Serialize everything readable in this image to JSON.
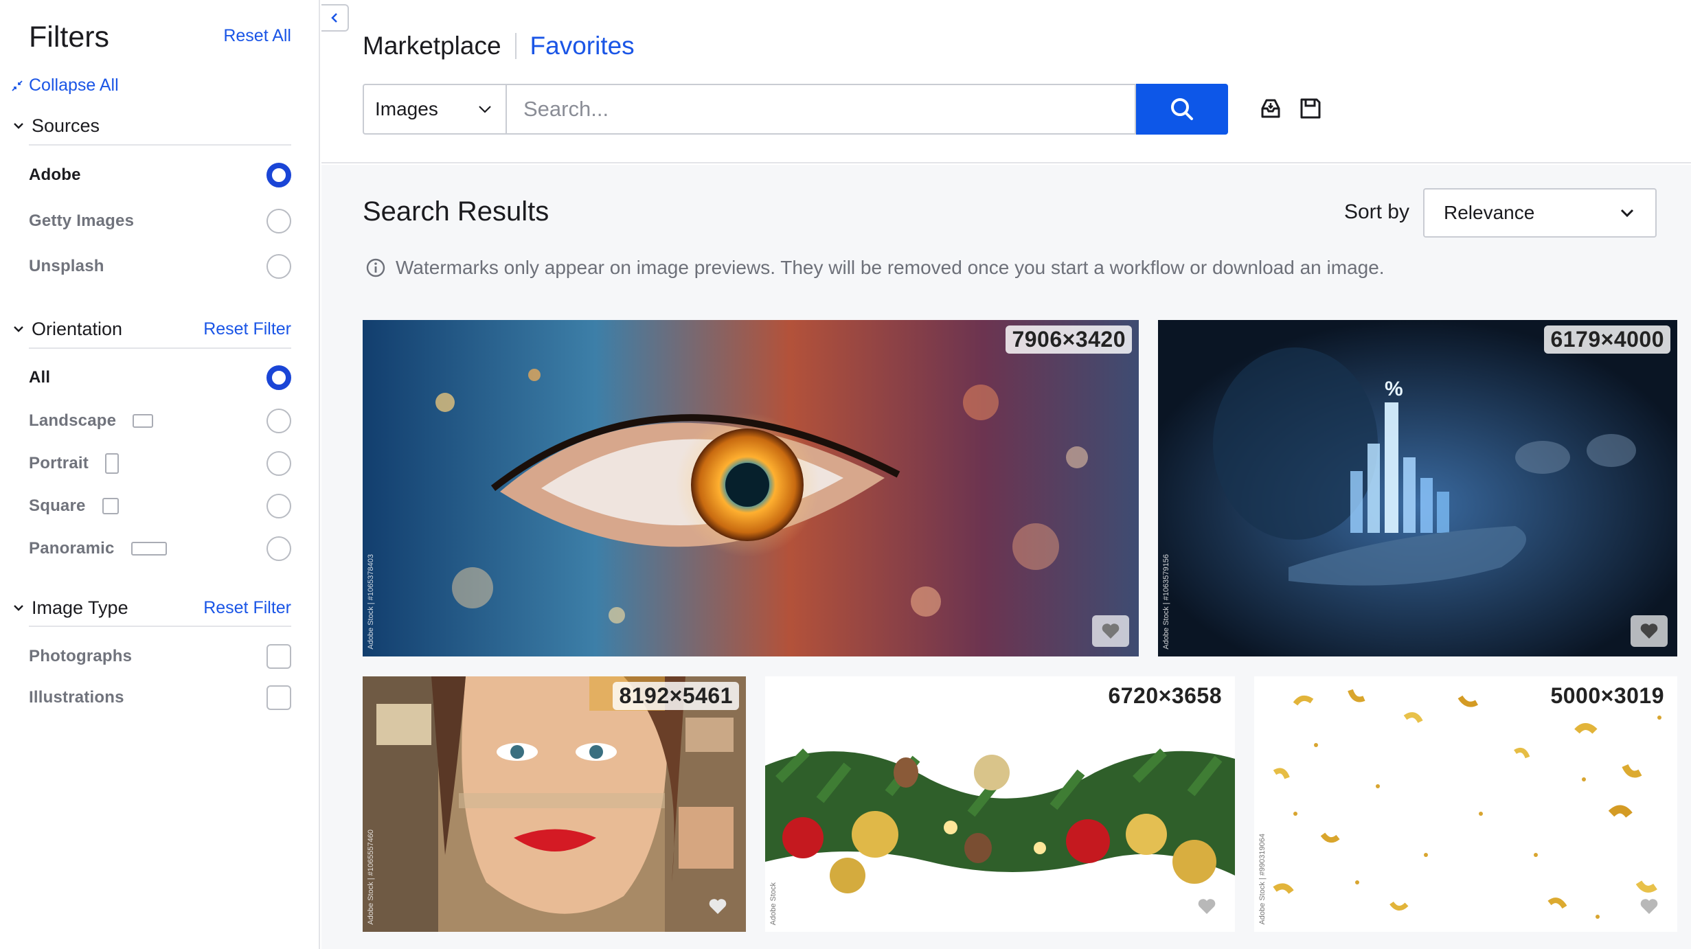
{
  "sidebar": {
    "title": "Filters",
    "reset_all": "Reset All",
    "collapse_all": "Collapse All",
    "sources": {
      "label": "Sources",
      "options": [
        {
          "label": "Adobe",
          "selected": true
        },
        {
          "label": "Getty Images",
          "selected": false
        },
        {
          "label": "Unsplash",
          "selected": false
        }
      ]
    },
    "orientation": {
      "label": "Orientation",
      "reset": "Reset Filter",
      "options": [
        {
          "label": "All",
          "selected": true
        },
        {
          "label": "Landscape",
          "selected": false
        },
        {
          "label": "Portrait",
          "selected": false
        },
        {
          "label": "Square",
          "selected": false
        },
        {
          "label": "Panoramic",
          "selected": false
        }
      ]
    },
    "image_type": {
      "label": "Image Type",
      "reset": "Reset Filter",
      "options": [
        {
          "label": "Photographs",
          "checked": false
        },
        {
          "label": "Illustrations",
          "checked": false
        }
      ]
    }
  },
  "header": {
    "breadcrumb_marketplace": "Marketplace",
    "breadcrumb_favorites": "Favorites",
    "type_select": "Images",
    "search_placeholder": "Search...",
    "icons": [
      "archive-icon",
      "save-icon"
    ]
  },
  "results": {
    "title": "Search Results",
    "sort_label": "Sort by",
    "sort_value": "Relevance",
    "notice": "Watermarks only appear on image previews. They will be removed once you start a workflow or download an image."
  },
  "tiles": [
    {
      "dims": "7906×3420",
      "subject": "eye",
      "watermark": "Adobe Stock | #1065378403"
    },
    {
      "dims": "6179×4000",
      "subject": "chart-hand",
      "watermark": "Adobe Stock | #1063579156"
    },
    {
      "dims": "8192×5461",
      "subject": "collage-face",
      "watermark": "Adobe Stock | #1065557460"
    },
    {
      "dims": "6720×3658",
      "subject": "garland",
      "watermark": "Adobe Stock"
    },
    {
      "dims": "5000×3019",
      "subject": "confetti",
      "watermark": "Adobe Stock | #990319064"
    }
  ],
  "colors": {
    "accent": "#1a55e6",
    "search_button": "#0d57e8",
    "radio_selected": "#1a45d6",
    "results_bg": "#f6f7f9"
  }
}
